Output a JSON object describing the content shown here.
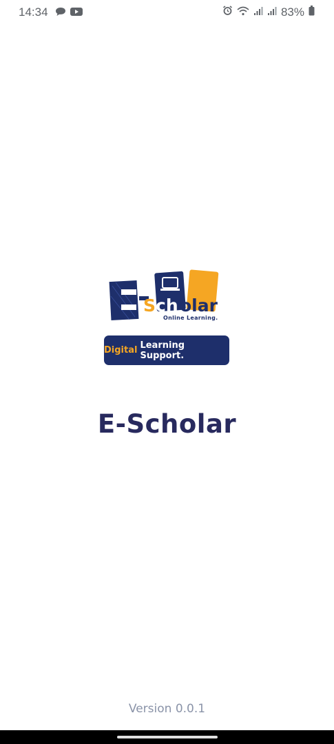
{
  "status_bar": {
    "time": "14:34",
    "battery": "83%",
    "left_icons": [
      "chat-bubble-icon",
      "youtube-icon"
    ],
    "right_icons": [
      "alarm-icon",
      "wifi-icon",
      "signal-icon",
      "signal-icon",
      "battery-icon"
    ]
  },
  "logo": {
    "text_e": "E-",
    "text_scholar": "Scholar",
    "tagline": "Online Learning."
  },
  "banner": {
    "highlight": "Digital",
    "rest": "Learning Support."
  },
  "app_title": "E-Scholar",
  "version": "Version 0.0.1",
  "colors": {
    "navy": "#1e2f6b",
    "orange": "#f5a623",
    "title": "#282a5e",
    "version": "#8a93a8"
  }
}
